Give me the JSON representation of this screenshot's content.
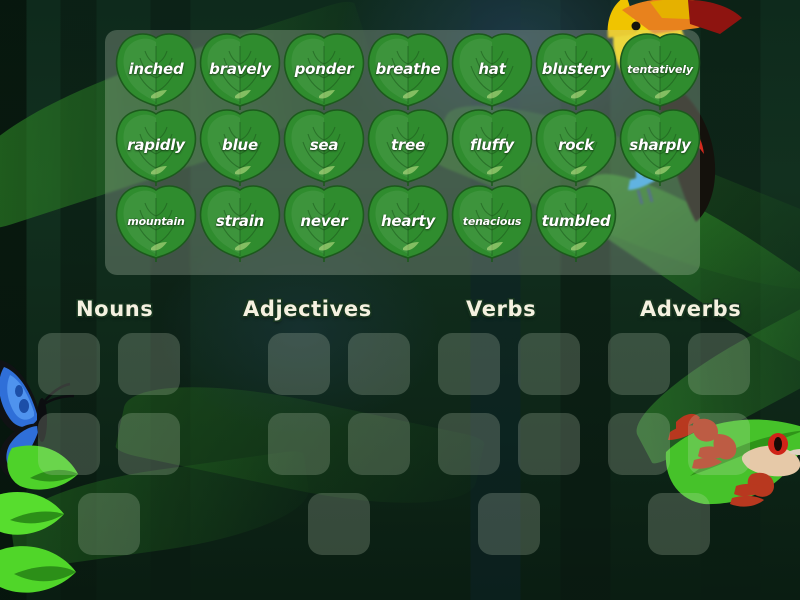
{
  "app": {
    "type": "word-sort-drag-drop-activity",
    "theme": "jungle"
  },
  "word_panel": {
    "rows": [
      [
        {
          "text": "inched",
          "size": "normal"
        },
        {
          "text": "bravely",
          "size": "normal"
        },
        {
          "text": "ponder",
          "size": "normal"
        },
        {
          "text": "breathe",
          "size": "normal"
        },
        {
          "text": "hat",
          "size": "normal"
        },
        {
          "text": "blustery",
          "size": "normal"
        },
        {
          "text": "tentatively",
          "size": "small"
        }
      ],
      [
        {
          "text": "rapidly",
          "size": "normal"
        },
        {
          "text": "blue",
          "size": "normal"
        },
        {
          "text": "sea",
          "size": "normal"
        },
        {
          "text": "tree",
          "size": "normal"
        },
        {
          "text": "fluffy",
          "size": "normal"
        },
        {
          "text": "rock",
          "size": "normal"
        },
        {
          "text": "sharply",
          "size": "normal"
        }
      ],
      [
        {
          "text": "mountain",
          "size": "small"
        },
        {
          "text": "strain",
          "size": "normal"
        },
        {
          "text": "never",
          "size": "normal"
        },
        {
          "text": "hearty",
          "size": "normal"
        },
        {
          "text": "tenacious",
          "size": "small"
        },
        {
          "text": "tumbled",
          "size": "normal"
        }
      ]
    ]
  },
  "categories": [
    {
      "label": "Nouns",
      "slots": 5
    },
    {
      "label": "Adjectives",
      "slots": 5
    },
    {
      "label": "Verbs",
      "slots": 5
    },
    {
      "label": "Adverbs",
      "slots": 5
    }
  ],
  "colors": {
    "leaf_fill": "#2e8b2e",
    "leaf_outline": "#1d5c1d",
    "panel_overlay": "#d6e2ce",
    "header_text": "#f5f1e0",
    "header_outline": "#17351f",
    "slot_fill": "#d0dec8",
    "background_dark": "#0d2417"
  }
}
